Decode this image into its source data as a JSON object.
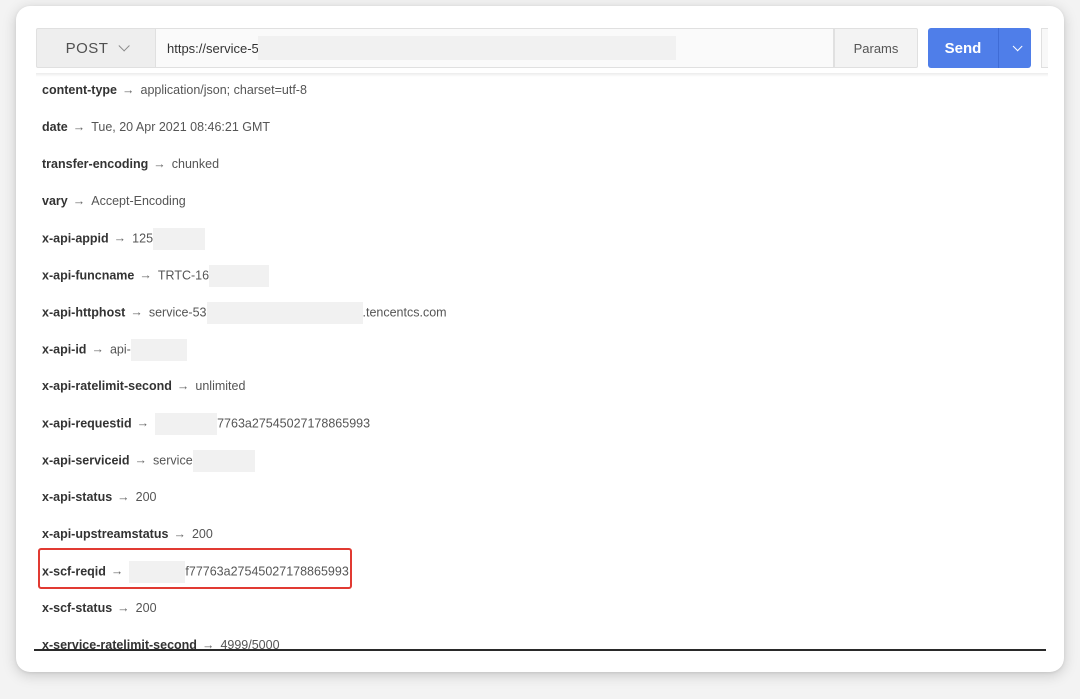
{
  "request": {
    "method": "POST",
    "url": "https://service-5",
    "params_label": "Params",
    "send_label": "Send"
  },
  "headers": [
    {
      "key": "content-type",
      "value": "application/json; charset=utf-8"
    },
    {
      "key": "date",
      "value": "Tue, 20 Apr 2021 08:46:21 GMT"
    },
    {
      "key": "transfer-encoding",
      "value": "chunked"
    },
    {
      "key": "vary",
      "value": "Accept-Encoding"
    },
    {
      "key": "x-api-appid",
      "value": "125"
    },
    {
      "key": "x-api-funcname",
      "value": "TRTC-16"
    },
    {
      "key": "x-api-httphost",
      "value": "service-53",
      "value_suffix": ".tencentcs.com"
    },
    {
      "key": "x-api-id",
      "value": "api-"
    },
    {
      "key": "x-api-ratelimit-second",
      "value": "unlimited"
    },
    {
      "key": "x-api-requestid",
      "value": "",
      "value_suffix": "7763a27545027178865993"
    },
    {
      "key": "x-api-serviceid",
      "value": "service"
    },
    {
      "key": "x-api-status",
      "value": "200"
    },
    {
      "key": "x-api-upstreamstatus",
      "value": "200"
    },
    {
      "key": "x-scf-reqid",
      "value": "",
      "value_suffix": "f77763a27545027178865993"
    },
    {
      "key": "x-scf-status",
      "value": "200"
    },
    {
      "key": "x-service-ratelimit-second",
      "value": "4999/5000"
    }
  ],
  "arrow_glyph": "→",
  "colors": {
    "send_button": "#4f7ee9",
    "highlight_border": "#e13a32"
  }
}
